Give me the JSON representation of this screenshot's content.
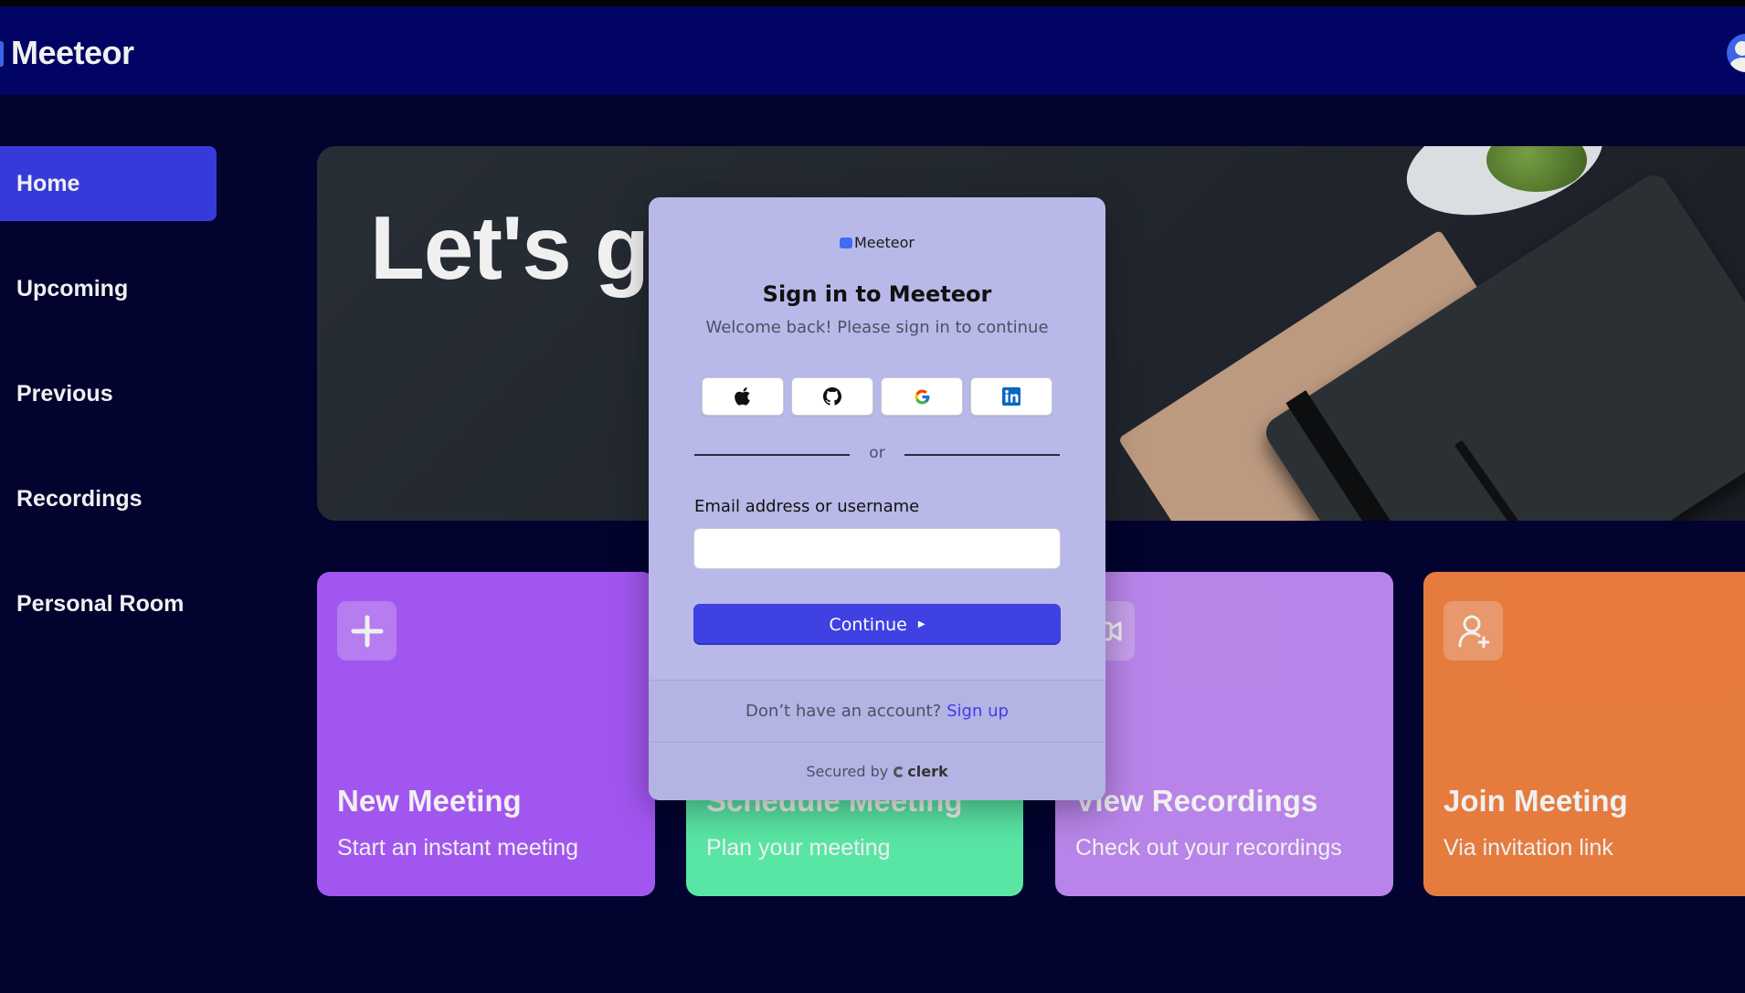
{
  "app": {
    "brand": "Meeteor"
  },
  "sidebar": {
    "items": [
      {
        "label": "Home",
        "active": true
      },
      {
        "label": "Upcoming"
      },
      {
        "label": "Previous"
      },
      {
        "label": "Recordings"
      },
      {
        "label": "Personal Room"
      }
    ]
  },
  "hero": {
    "title": "Let's get started!"
  },
  "cards": [
    {
      "title": "New Meeting",
      "subtitle": "Start an instant meeting",
      "color": "#ad5cff",
      "icon": "plus-icon"
    },
    {
      "title": "Schedule Meeting",
      "subtitle": "Plan your meeting",
      "color": "#5ff5b0",
      "icon": "calendar-icon"
    },
    {
      "title": "View Recordings",
      "subtitle": "Check out your recordings",
      "color": "#c48df8",
      "icon": "video-icon"
    },
    {
      "title": "Join Meeting",
      "subtitle": "Via invitation link",
      "color": "#f58342",
      "icon": "user-add-icon"
    }
  ],
  "signin": {
    "logo_text": "Meeteor",
    "title": "Sign in to Meeteor",
    "subtitle": "Welcome back! Please sign in to continue",
    "social": [
      "apple-icon",
      "github-icon",
      "google-icon",
      "linkedin-icon"
    ],
    "divider": "or",
    "email_label": "Email address or username",
    "email_value": "",
    "continue_label": "Continue",
    "no_account_text": "Don’t have an account?",
    "signup_link": "Sign up",
    "secured_by": "Secured by",
    "provider": "clerk"
  },
  "colors": {
    "background": "#030432",
    "navbar": "#02056b",
    "accent": "#3b3ee8",
    "modal": "#b8b9e8"
  }
}
